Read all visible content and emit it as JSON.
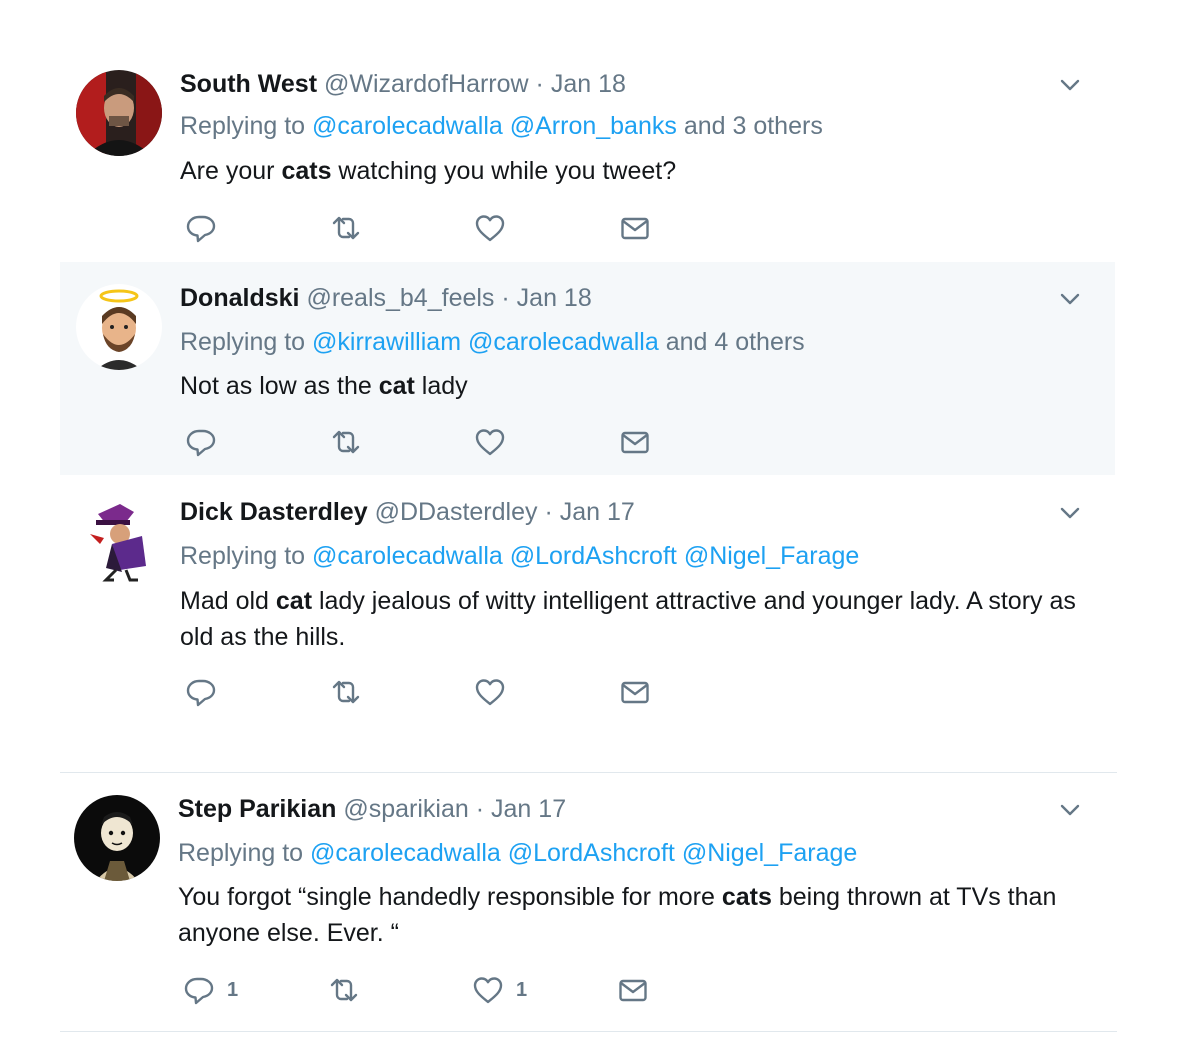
{
  "tweets": [
    {
      "name": "South West",
      "handle": "@WizardofHarrow",
      "sep": "·",
      "date": "Jan 18",
      "reply_prefix": "Replying to",
      "mentions": [
        "@carolecadwalla",
        "@Arron_banks"
      ],
      "reply_suffix": "and 3 others",
      "text": [
        {
          "t": "Are your "
        },
        {
          "b": "cats"
        },
        {
          "t": " watching you while you tweet?"
        }
      ],
      "reply_count": "",
      "like_count": ""
    },
    {
      "name": "Donaldski",
      "handle": "@reals_b4_feels",
      "sep": "·",
      "date": "Jan 18",
      "reply_prefix": "Replying to",
      "mentions": [
        "@kirrawilliam",
        "@carolecadwalla"
      ],
      "reply_suffix": "and 4 others",
      "text": [
        {
          "t": "Not as low as the "
        },
        {
          "b": "cat"
        },
        {
          "t": " lady"
        }
      ],
      "reply_count": "",
      "like_count": ""
    },
    {
      "name": "Dick Dasterdley",
      "handle": "@DDasterdley",
      "sep": "·",
      "date": "Jan 17",
      "reply_prefix": "Replying to",
      "mentions": [
        "@carolecadwalla",
        "@LordAshcroft",
        "@Nigel_Farage"
      ],
      "reply_suffix": "",
      "text": [
        {
          "t": "Mad old "
        },
        {
          "b": "cat"
        },
        {
          "t": " lady jealous of witty intelligent attractive and younger lady. A story as old as the hills."
        }
      ],
      "reply_count": "",
      "like_count": ""
    },
    {
      "name": "Step Parikian",
      "handle": "@sparikian",
      "sep": "·",
      "date": "Jan 17",
      "reply_prefix": "Replying to",
      "mentions": [
        "@carolecadwalla",
        "@LordAshcroft",
        "@Nigel_Farage"
      ],
      "reply_suffix": "",
      "text": [
        {
          "t": "You forgot “single handedly responsible for more "
        },
        {
          "b": "cats"
        },
        {
          "t": " being thrown at TVs than anyone else. Ever. “"
        }
      ],
      "reply_count": "1",
      "like_count": "1"
    }
  ],
  "colors": {
    "link": "#1da1f2",
    "muted": "#657786",
    "text": "#14171a",
    "highlight_bg": "#f5f8fa"
  },
  "icons": [
    "reply-icon",
    "retweet-icon",
    "like-icon",
    "direct-message-icon",
    "chevron-down-icon"
  ]
}
